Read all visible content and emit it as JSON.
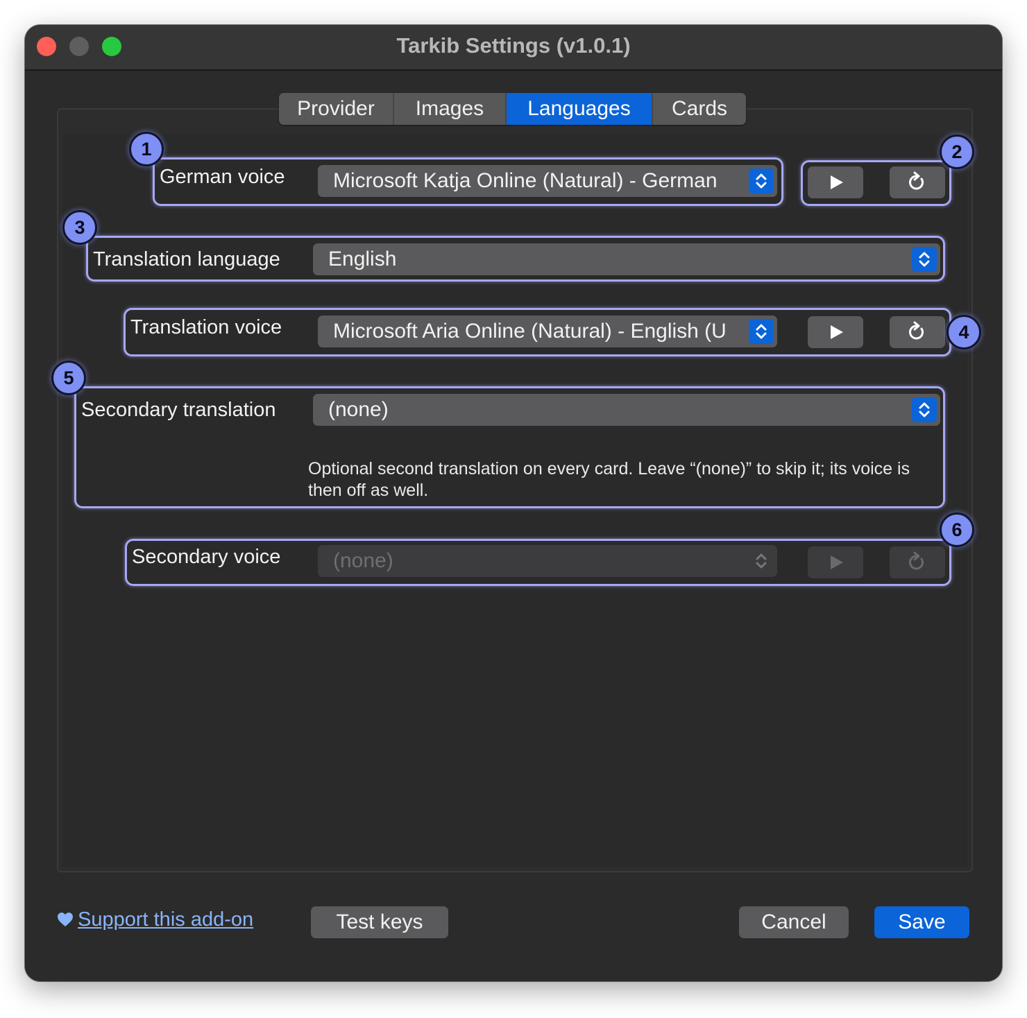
{
  "window": {
    "title": "Tarkib Settings (v1.0.1)"
  },
  "tabs": [
    {
      "label": "Provider"
    },
    {
      "label": "Images"
    },
    {
      "label": "Languages"
    },
    {
      "label": "Cards"
    }
  ],
  "active_tab": "Languages",
  "rows": {
    "german_voice": {
      "label": "German voice",
      "value": "Microsoft Katja Online (Natural) - German"
    },
    "translation_language": {
      "label": "Translation language",
      "value": "English"
    },
    "translation_voice": {
      "label": "Translation voice",
      "value": "Microsoft Aria Online (Natural) - English (U"
    },
    "secondary_translation": {
      "label": "Secondary translation",
      "value": "(none)",
      "help": "Optional second translation on every card. Leave “(none)” to skip it; its voice is then off as well."
    },
    "secondary_voice": {
      "label": "Secondary voice",
      "value": "(none)",
      "disabled": true
    }
  },
  "badges": [
    "1",
    "2",
    "3",
    "4",
    "5",
    "6"
  ],
  "footer": {
    "support_link": "Support this add-on",
    "test_keys": "Test keys",
    "cancel": "Cancel",
    "save": "Save"
  },
  "colors": {
    "accent": "#0b64d8",
    "highlight": "#a6a8f5",
    "badge": "#7e90f4"
  },
  "icons": [
    "play-icon",
    "refresh-icon",
    "updown-chevron-icon",
    "heart-icon"
  ]
}
